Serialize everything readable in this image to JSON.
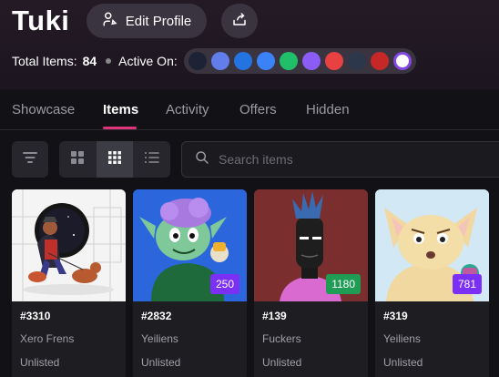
{
  "profile": {
    "name": "Tuki",
    "edit_label": "Edit Profile",
    "total_items_label": "Total Items:",
    "total_items_value": "84",
    "active_on_label": "Active On:",
    "chains": [
      {
        "name": "chain-1",
        "color": "#1e2235"
      },
      {
        "name": "ethereum",
        "color": "#627eea"
      },
      {
        "name": "chain-3",
        "color": "#2374e1"
      },
      {
        "name": "chain-4",
        "color": "#3b82f6"
      },
      {
        "name": "chain-5",
        "color": "#20c06a"
      },
      {
        "name": "chain-6",
        "color": "#8b5cf6"
      },
      {
        "name": "avalanche",
        "color": "#e84142"
      },
      {
        "name": "arbitrum",
        "color": "#2d374b"
      },
      {
        "name": "chain-9",
        "color": "#c62828"
      },
      {
        "name": "polygon",
        "color": "#ffffff"
      }
    ]
  },
  "tabs": [
    {
      "label": "Showcase"
    },
    {
      "label": "Items"
    },
    {
      "label": "Activity"
    },
    {
      "label": "Offers"
    },
    {
      "label": "Hidden"
    }
  ],
  "active_tab": "Items",
  "search": {
    "placeholder": "Search items"
  },
  "items": [
    {
      "id": "#3310",
      "collection": "Xero Frens",
      "status": "Unlisted",
      "badge": "",
      "badge_color": ""
    },
    {
      "id": "#2832",
      "collection": "Yeiliens",
      "status": "Unlisted",
      "badge": "250",
      "badge_color": "#7b2ff7"
    },
    {
      "id": "#139",
      "collection": "Fuckers",
      "status": "Unlisted",
      "badge": "1180",
      "badge_color": "#1f9d55"
    },
    {
      "id": "#319",
      "collection": "Yeiliens",
      "status": "Unlisted",
      "badge": "781",
      "badge_color": "#7b2ff7"
    }
  ]
}
